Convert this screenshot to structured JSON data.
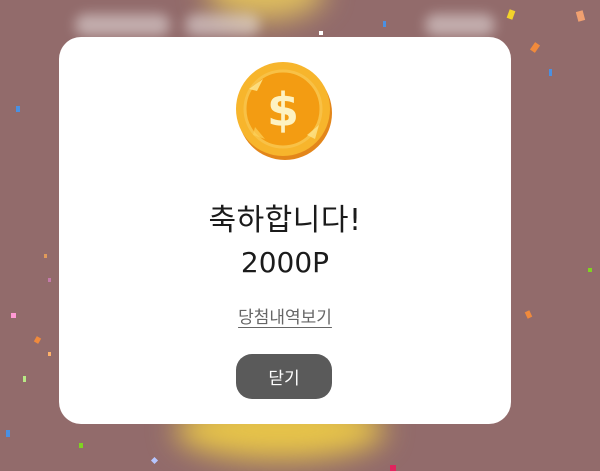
{
  "modal": {
    "title": "축하합니다!",
    "points": "2000P",
    "history_link": "당첨내역보기",
    "close_label": "닫기"
  },
  "coin": {
    "icon": "dollar-coin-icon",
    "symbol": "$"
  },
  "colors": {
    "backdrop": "#926b6b",
    "modal_bg": "#ffffff",
    "close_button_bg": "#5a5a5a",
    "coin_gold": "#f5a623"
  }
}
